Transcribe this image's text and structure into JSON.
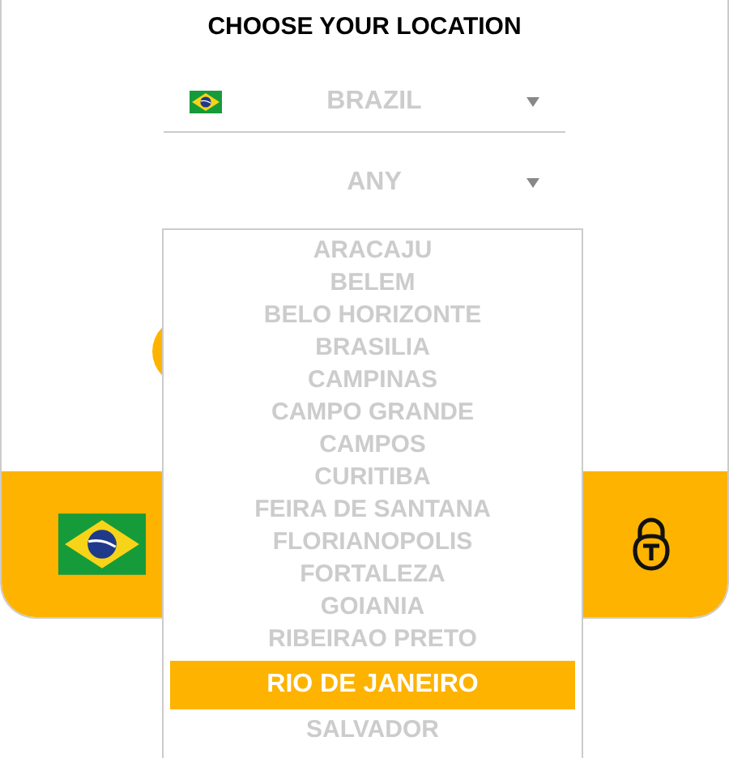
{
  "title": "CHOOSE YOUR LOCATION",
  "country_select": {
    "value": "BRAZIL"
  },
  "city_select": {
    "value": "ANY"
  },
  "city_list": [
    {
      "label": "ARACAJU",
      "selected": false
    },
    {
      "label": "BELEM",
      "selected": false
    },
    {
      "label": "BELO HORIZONTE",
      "selected": false
    },
    {
      "label": "BRASILIA",
      "selected": false
    },
    {
      "label": "CAMPINAS",
      "selected": false
    },
    {
      "label": "CAMPO GRANDE",
      "selected": false
    },
    {
      "label": "CAMPOS",
      "selected": false
    },
    {
      "label": "CURITIBA",
      "selected": false
    },
    {
      "label": "FEIRA DE SANTANA",
      "selected": false
    },
    {
      "label": "FLORIANOPOLIS",
      "selected": false
    },
    {
      "label": "FORTALEZA",
      "selected": false
    },
    {
      "label": "GOIANIA",
      "selected": false
    },
    {
      "label": "RIBEIRAO PRETO",
      "selected": false
    },
    {
      "label": "RIO DE JANEIRO",
      "selected": true
    },
    {
      "label": "SALVADOR",
      "selected": false
    }
  ]
}
